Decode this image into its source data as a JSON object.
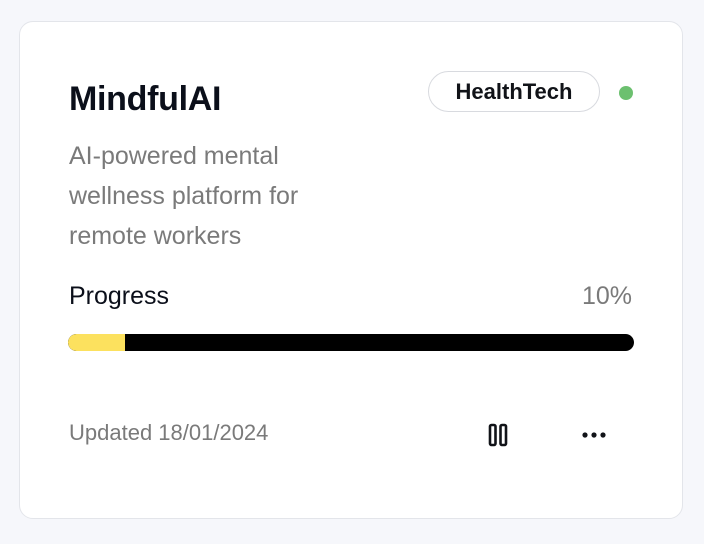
{
  "card": {
    "title": "MindfulAI",
    "category": "HealthTech",
    "status_color": "#6cc06f",
    "description": "AI-powered mental wellness platform for remote workers",
    "progress": {
      "label": "Progress",
      "value_text": "10%",
      "fraction": 0.1,
      "fill_color": "#fce15e",
      "track_color": "#000000"
    },
    "updated": "Updated 18/01/2024",
    "actions": {
      "pause_icon": "pause-icon",
      "more_icon": "more-horizontal-icon"
    }
  }
}
